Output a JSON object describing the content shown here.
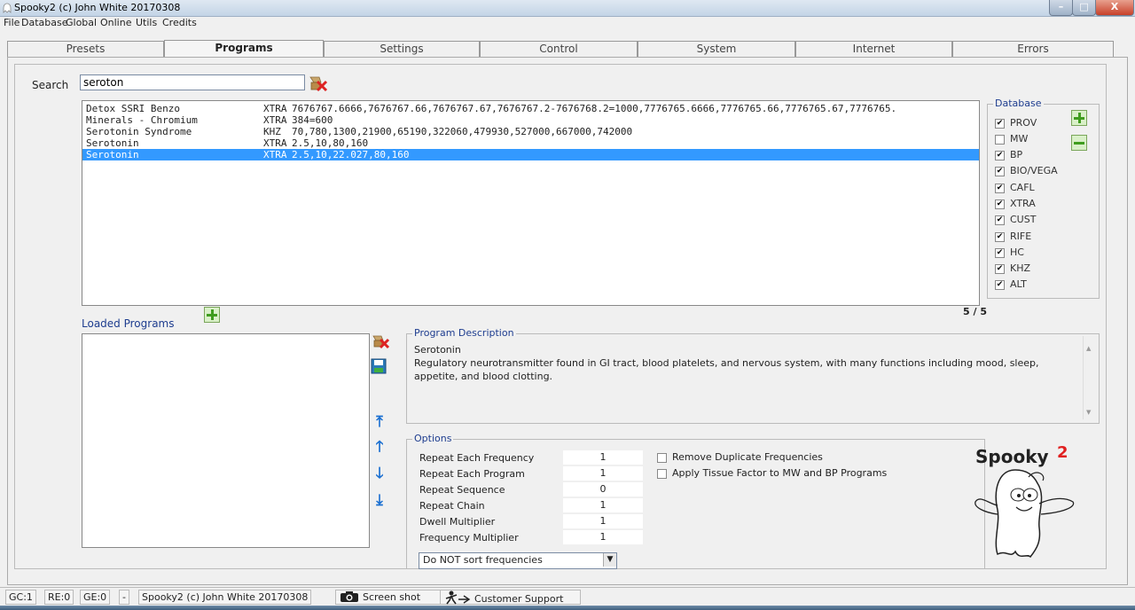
{
  "window": {
    "title": "Spooky2 (c) John White 20170308",
    "controls": {
      "minimize": "–",
      "maximize": "□",
      "close": "X"
    }
  },
  "menu": [
    "File",
    "Database",
    "Global",
    "Online",
    "Utils",
    "Credits"
  ],
  "tabs": [
    {
      "label": "Presets",
      "active": false
    },
    {
      "label": "Programs",
      "active": true
    },
    {
      "label": "Settings",
      "active": false
    },
    {
      "label": "Control",
      "active": false
    },
    {
      "label": "System",
      "active": false
    },
    {
      "label": "Internet",
      "active": false
    },
    {
      "label": "Errors",
      "active": false
    }
  ],
  "search": {
    "label": "Search",
    "value": "seroton"
  },
  "results": [
    {
      "name": "Detox SSRI Benzo",
      "db": "XTRA",
      "freqs": "7676767.6666,7676767.66,7676767.67,7676767.2-7676768.2=1000,7776765.6666,7776765.66,7776765.67,7776765."
    },
    {
      "name": "Minerals - Chromium",
      "db": "XTRA",
      "freqs": "384=600"
    },
    {
      "name": "Serotonin Syndrome",
      "db": "KHZ",
      "freqs": "70,780,1300,21900,65190,322060,479930,527000,667000,742000"
    },
    {
      "name": "Serotonin",
      "db": "XTRA",
      "freqs": "2.5,10,80,160"
    },
    {
      "name": "Serotonin",
      "db": "XTRA",
      "freqs": "2.5,10,22.027,80,160",
      "selected": true
    }
  ],
  "database": {
    "title": "Database",
    "items": [
      {
        "label": "PROV",
        "checked": true
      },
      {
        "label": "MW",
        "checked": false
      },
      {
        "label": "BP",
        "checked": true
      },
      {
        "label": "BIO/VEGA",
        "checked": true
      },
      {
        "label": "CAFL",
        "checked": true
      },
      {
        "label": "XTRA",
        "checked": true
      },
      {
        "label": "CUST",
        "checked": true
      },
      {
        "label": "RIFE",
        "checked": true
      },
      {
        "label": "HC",
        "checked": true
      },
      {
        "label": "KHZ",
        "checked": true
      },
      {
        "label": "ALT",
        "checked": true
      }
    ]
  },
  "count": "5 / 5",
  "loaded_programs": {
    "label": "Loaded Programs"
  },
  "description": {
    "title": "Program Description",
    "name": "Serotonin",
    "text": "Regulatory neurotransmitter found in GI tract, blood platelets, and nervous system, with many functions including mood, sleep, appetite, and blood clotting."
  },
  "options": {
    "title": "Options",
    "rows": [
      {
        "label": "Repeat Each Frequency",
        "value": "1"
      },
      {
        "label": "Repeat Each Program",
        "value": "1"
      },
      {
        "label": "Repeat Sequence",
        "value": "0"
      },
      {
        "label": "Repeat Chain",
        "value": "1"
      },
      {
        "label": "Dwell Multiplier",
        "value": "1"
      },
      {
        "label": "Frequency Multiplier",
        "value": "1"
      }
    ],
    "checks": [
      {
        "label": "Remove Duplicate Frequencies",
        "checked": false
      },
      {
        "label": "Apply Tissue Factor to MW and BP Programs",
        "checked": false
      }
    ],
    "sort": "Do NOT sort frequencies"
  },
  "logo": {
    "text": "Spooky",
    "superscript": "2"
  },
  "statusbar": {
    "gc": "GC:1",
    "re": "RE:0",
    "ge": "GE:0",
    "dash": "-",
    "title": "Spooky2 (c) John White 20170308",
    "screenshot": "Screen shot",
    "support": "Customer Support"
  },
  "colors": {
    "selection": "#3399ff",
    "accent_label": "#1e3d8f",
    "plus_green": "#3f9d1e",
    "arrow_blue": "#1a6fd1",
    "logo_red": "#e02020"
  }
}
